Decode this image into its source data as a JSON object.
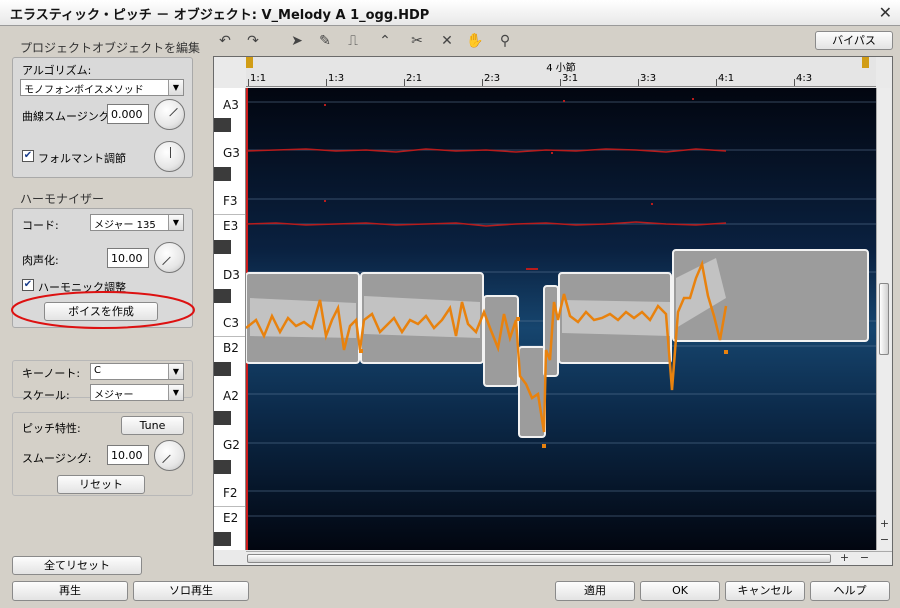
{
  "window": {
    "title": "エラスティック・ピッチ － オブジェクト: V_Melody A 1_ogg.HDP"
  },
  "left": {
    "project_section": "プロジェクトオブジェクトを編集",
    "algorithm_label": "アルゴリズム:",
    "algorithm_value": "モノフォンボイスメソッド",
    "curve_smoothing_label": "曲線スムージング:",
    "curve_smoothing_value": "0.000",
    "formant_label": "フォルマント調節",
    "harmonizer_section": "ハーモナイザー",
    "chord_label": "コード:",
    "chord_value": "メジャー 135",
    "humanize_label": "肉声化:",
    "humanize_value": "10.00",
    "harmonic_label": "ハーモニック調整",
    "create_voice_button": "ボイスを作成",
    "key_note_label": "キーノート:",
    "key_note_value": "C",
    "scale_label": "スケール:",
    "scale_value": "メジャー",
    "pitch_label": "ピッチ特性:",
    "tune_button": "Tune",
    "smoothing_label": "スムージング:",
    "smoothing_value": "10.00",
    "reset_button": "リセット",
    "reset_all_button": "全てリセット"
  },
  "toolbar": {
    "tools": [
      "undo-icon",
      "redo-icon",
      "pointer-icon",
      "pencil-icon",
      "pulse-tool-icon",
      "curve-tool-icon",
      "scissors-icon",
      "erase-icon",
      "hand-icon",
      "zoom-icon"
    ],
    "bypass_button": "バイパス"
  },
  "editor": {
    "measure_label": "4 小節",
    "ruler_ticks": [
      "1:1",
      "1:3",
      "2:1",
      "2:3",
      "3:1",
      "3:3",
      "4:1",
      "4:3"
    ],
    "notes": [
      "A3",
      "G3",
      "F3",
      "E3",
      "D3",
      "C3",
      "B2",
      "A2",
      "G2",
      "F2",
      "E2"
    ]
  },
  "footer": {
    "play_button": "再生",
    "solo_play_button": "ソロ再生",
    "apply_button": "適用",
    "ok_button": "OK",
    "cancel_button": "キャンセル",
    "help_button": "ヘルプ"
  },
  "colors": {
    "note_box": "#9c9c9c",
    "pitch_curve": "#e8820e",
    "harmony_line": "#b81c1c",
    "annotation": "#dd1111"
  }
}
